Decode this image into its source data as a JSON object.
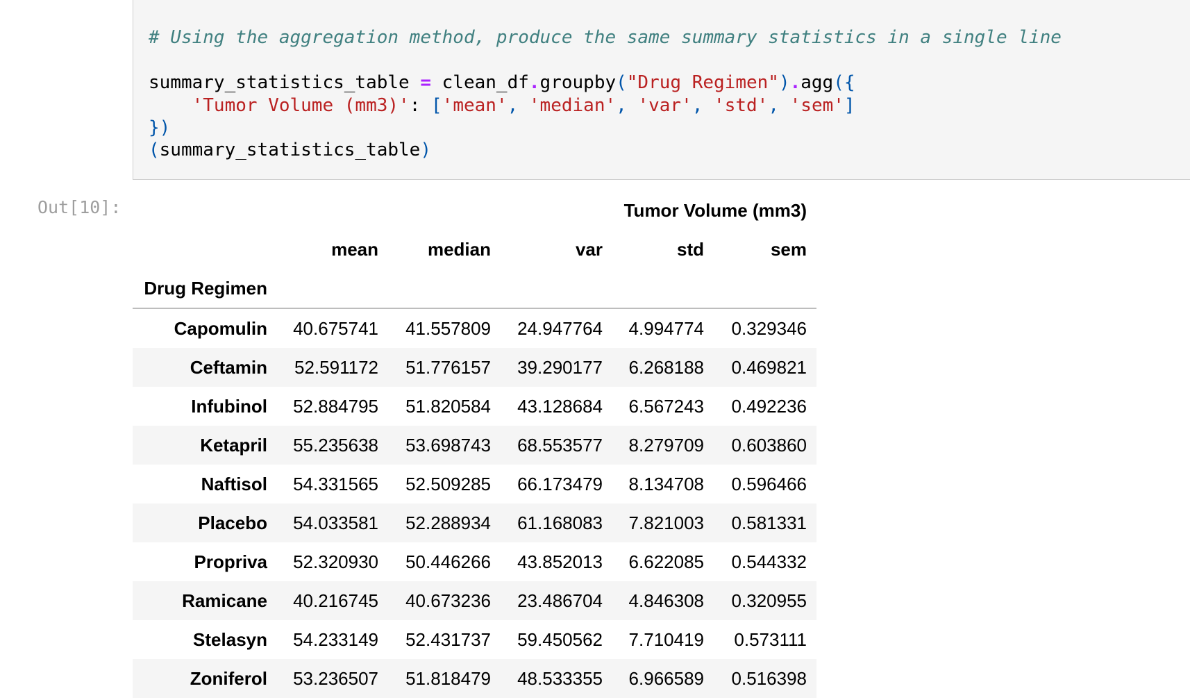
{
  "code": {
    "comment": "# Using the aggregation method, produce the same summary statistics in a single line",
    "line1": {
      "var": "summary_statistics_table",
      "op": "=",
      "obj": "clean_df",
      "method1": "groupby",
      "arg": "\"Drug Regimen\"",
      "method2": "agg",
      "open": "({"
    },
    "line2": {
      "key": "'Tumor Volume (mm3)'",
      "items": [
        "'mean'",
        "'median'",
        "'var'",
        "'std'",
        "'sem'"
      ]
    },
    "line3": "})",
    "line4": {
      "name": "summary_statistics_table"
    }
  },
  "output": {
    "prompt": "Out[10]:",
    "column_group": "Tumor Volume (mm3)",
    "columns": [
      "mean",
      "median",
      "var",
      "std",
      "sem"
    ],
    "index_name": "Drug Regimen",
    "rows": [
      {
        "label": "Capomulin",
        "values": [
          "40.675741",
          "41.557809",
          "24.947764",
          "4.994774",
          "0.329346"
        ]
      },
      {
        "label": "Ceftamin",
        "values": [
          "52.591172",
          "51.776157",
          "39.290177",
          "6.268188",
          "0.469821"
        ]
      },
      {
        "label": "Infubinol",
        "values": [
          "52.884795",
          "51.820584",
          "43.128684",
          "6.567243",
          "0.492236"
        ]
      },
      {
        "label": "Ketapril",
        "values": [
          "55.235638",
          "53.698743",
          "68.553577",
          "8.279709",
          "0.603860"
        ]
      },
      {
        "label": "Naftisol",
        "values": [
          "54.331565",
          "52.509285",
          "66.173479",
          "8.134708",
          "0.596466"
        ]
      },
      {
        "label": "Placebo",
        "values": [
          "54.033581",
          "52.288934",
          "61.168083",
          "7.821003",
          "0.581331"
        ]
      },
      {
        "label": "Propriva",
        "values": [
          "52.320930",
          "50.446266",
          "43.852013",
          "6.622085",
          "0.544332"
        ]
      },
      {
        "label": "Ramicane",
        "values": [
          "40.216745",
          "40.673236",
          "23.486704",
          "4.846308",
          "0.320955"
        ]
      },
      {
        "label": "Stelasyn",
        "values": [
          "54.233149",
          "52.431737",
          "59.450562",
          "7.710419",
          "0.573111"
        ]
      },
      {
        "label": "Zoniferol",
        "values": [
          "53.236507",
          "51.818479",
          "48.533355",
          "6.966589",
          "0.516398"
        ]
      }
    ]
  }
}
